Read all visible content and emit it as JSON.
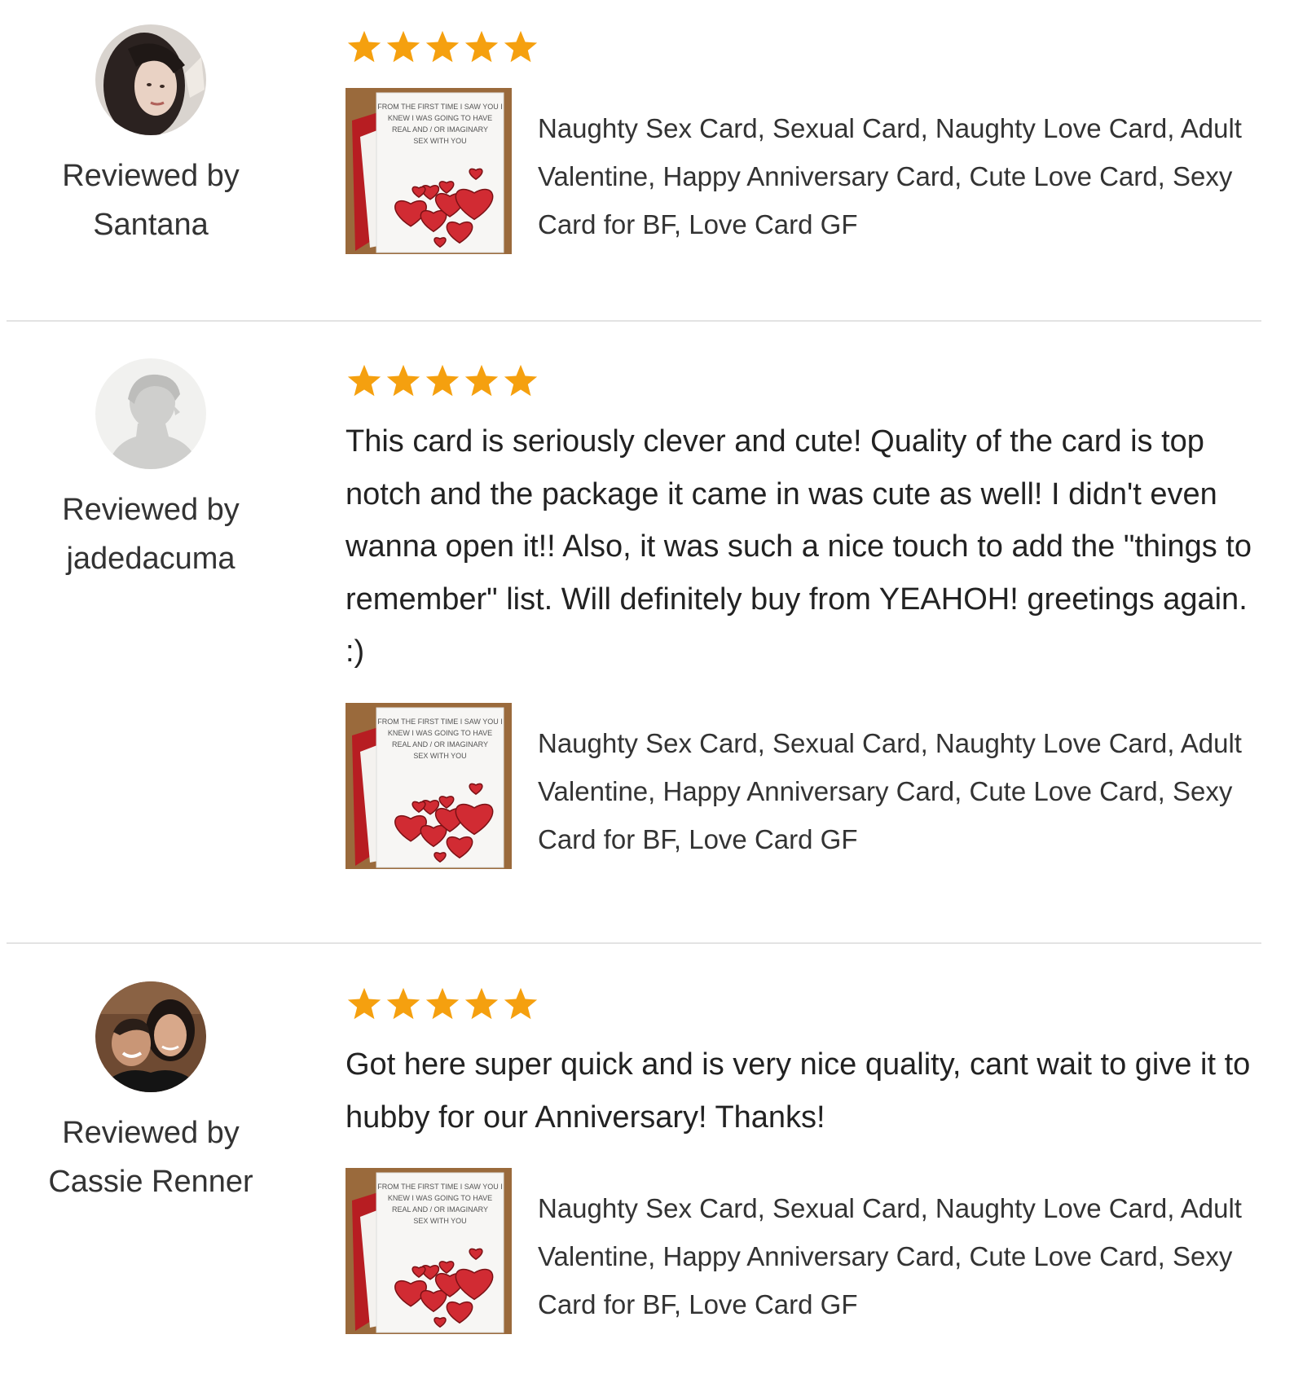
{
  "colors": {
    "star": "#f5a00f",
    "divider": "#e3e3e3",
    "text": "#222222"
  },
  "reviews": [
    {
      "reviewed_by_label": "Reviewed by",
      "reviewer_name": "Santana",
      "rating": 5,
      "text": "",
      "listing_title": "Naughty Sex Card, Sexual Card, Naughty Love Card, Adult Valentine, Happy Anniversary Card, Cute Love Card, Sexy Card for BF, Love Card GF"
    },
    {
      "reviewed_by_label": "Reviewed by",
      "reviewer_name": "jadedacuma",
      "rating": 5,
      "text": "This card is seriously clever and cute! Quality of the card is top notch and the package it came in was cute as well! I didn't even wanna open it!! Also, it was such a nice touch to add the \"things to remember\" list. Will definitely buy from YEAHOH! greetings again. :)",
      "listing_title": "Naughty Sex Card, Sexual Card, Naughty Love Card, Adult Valentine, Happy Anniversary Card, Cute Love Card, Sexy Card for BF, Love Card GF"
    },
    {
      "reviewed_by_label": "Reviewed by",
      "reviewer_name": "Cassie Renner",
      "rating": 5,
      "text": "Got here super quick and is very nice quality, cant wait to give it to hubby for our Anniversary! Thanks!",
      "listing_title": "Naughty Sex Card, Sexual Card, Naughty Love Card, Adult Valentine, Happy Anniversary Card, Cute Love Card, Sexy Card for BF, Love Card GF"
    }
  ],
  "card_image_text": "FROM THE FIRST TIME I SAW YOU I KNEW I WAS GOING TO HAVE REAL AND / OR IMAGINARY SEX WITH YOU"
}
